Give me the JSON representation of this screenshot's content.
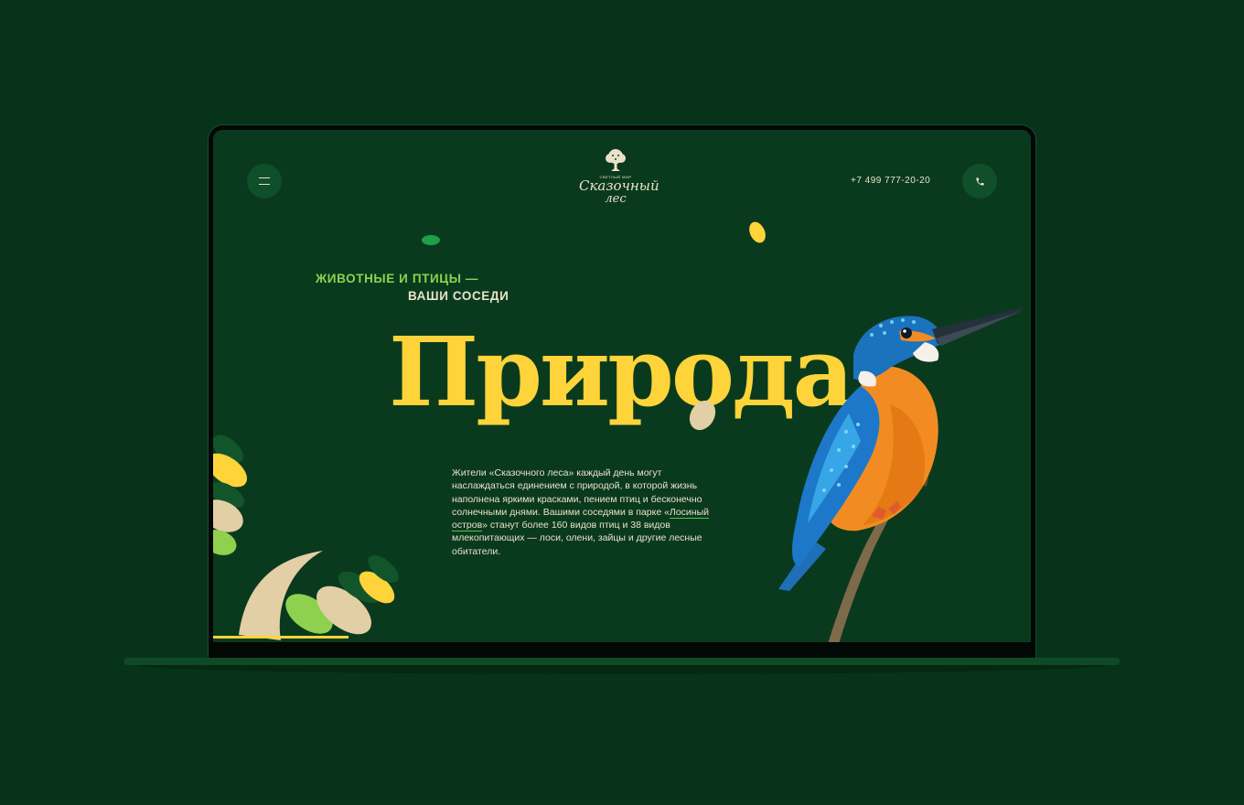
{
  "header": {
    "menu_icon": "hamburger-menu-icon",
    "logo": {
      "small": "СВЕТЛЫЙ МИР",
      "main": "Сказочный",
      "sub": "лес"
    },
    "phone": "+7 499 777-20-20",
    "phone_icon": "phone-icon"
  },
  "hero": {
    "tagline_line1": "ЖИВОТНЫЕ И ПТИЦЫ —",
    "tagline_line2": "ВАШИ СОСЕДИ",
    "title": "Природа",
    "text_part1": "Жители «Сказочного леса» каждый день могут наслаждаться единением с природой, в которой жизнь наполнена яркими красками, пением птиц и бесконечно солнечными днями. Вашими соседями в парке «",
    "text_link": "Лосиный остров",
    "text_part2": "» станут более 160 видов птиц и 38 видов млекопитающих — лоси, олени, зайцы и другие лесные обитатели.",
    "image": "kingfisher-bird-image"
  },
  "slider": {
    "progress": 0.165
  },
  "colors": {
    "background": "#07331b",
    "screen": "#0a3a1e",
    "accent_yellow": "#ffd43a",
    "accent_green": "#8fd14f",
    "text_light": "#e9e2c8"
  }
}
